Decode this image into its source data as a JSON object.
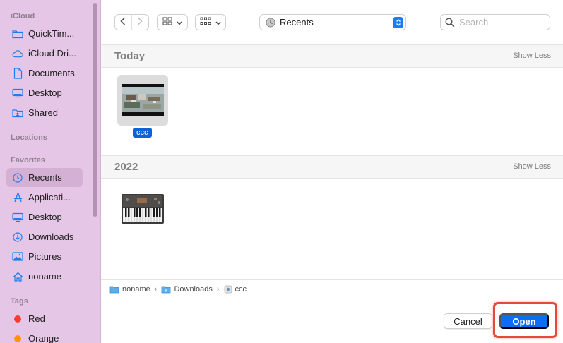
{
  "sidebar": {
    "sections": {
      "icloud": "iCloud",
      "locations": "Locations",
      "favorites": "Favorites",
      "tags": "Tags"
    },
    "icloud_items": [
      {
        "label": "QuickTim...",
        "icon": "folder-icon"
      },
      {
        "label": "iCloud Dri...",
        "icon": "cloud-icon"
      },
      {
        "label": "Documents",
        "icon": "document-icon"
      },
      {
        "label": "Desktop",
        "icon": "desktop-icon"
      },
      {
        "label": "Shared",
        "icon": "shared-folder-icon"
      }
    ],
    "favorites_items": [
      {
        "label": "Recents",
        "icon": "clock-icon",
        "selected": true
      },
      {
        "label": "Applicati...",
        "icon": "applications-icon"
      },
      {
        "label": "Desktop",
        "icon": "desktop-icon"
      },
      {
        "label": "Downloads",
        "icon": "download-icon"
      },
      {
        "label": "Pictures",
        "icon": "photo-icon"
      },
      {
        "label": "noname",
        "icon": "home-icon"
      }
    ],
    "tags": [
      {
        "label": "Red",
        "color": "#ff3b30"
      },
      {
        "label": "Orange",
        "color": "#ff9500"
      }
    ]
  },
  "toolbar": {
    "location": "Recents",
    "search_placeholder": "Search"
  },
  "content": {
    "groups": [
      {
        "title": "Today",
        "action": "Show Less",
        "files": [
          {
            "name": "ccc",
            "selected": true
          }
        ]
      },
      {
        "title": "2022",
        "action": "Show Less",
        "files": [
          {
            "name": "",
            "selected": false
          }
        ]
      }
    ]
  },
  "pathbar": [
    "noname",
    "Downloads",
    "ccc"
  ],
  "footer": {
    "cancel": "Cancel",
    "open": "Open"
  },
  "colors": {
    "sidebar_bg": "#e6c6e6",
    "accent": "#0a6ef2",
    "highlight": "#e5493a"
  }
}
